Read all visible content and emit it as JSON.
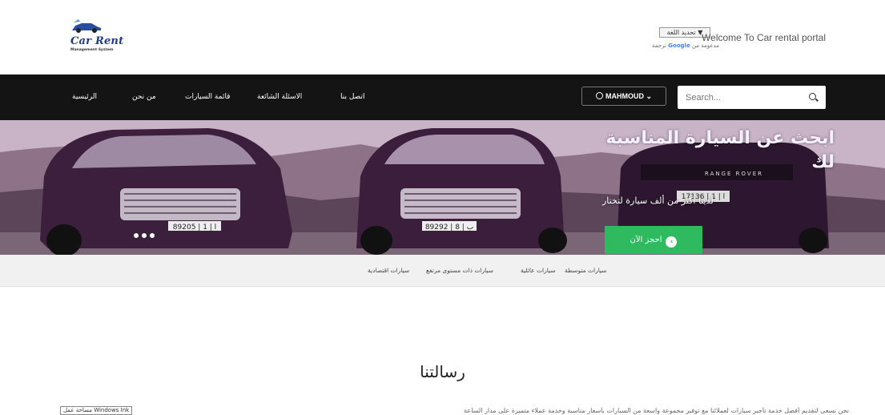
{
  "header": {
    "brand_name": "Car Rent",
    "brand_tagline": "Management System",
    "welcome_text": "Welcome To Car rental portal",
    "language_select": "تحديد اللغة ▼",
    "translate_powered": "مدعومة من",
    "translate_google": "Google",
    "translate_label": "ترجمة"
  },
  "nav": {
    "items": [
      {
        "label": "الرئيسية"
      },
      {
        "label": "من نحن"
      },
      {
        "label": "قائمة السيارات"
      },
      {
        "label": "الاسئلة الشائعة"
      },
      {
        "label": "اتصل بنا"
      }
    ],
    "user_label": "MAHMOUD",
    "search_placeholder": "Search..."
  },
  "hero": {
    "title": "ابحث عن السيارة المناسبة لك",
    "subtitle": "لدينا أكثر من ألف سيارة لتختار",
    "cta_label": "احجز الآن",
    "plates": [
      "89205 | ا | 1",
      "89292 | ب | 8",
      "17136 | ا | 1"
    ],
    "rover_text": "RANGE ROVER"
  },
  "categories": [
    {
      "label": "سيارات متوسطة"
    },
    {
      "label": "سيارات عائلية"
    },
    {
      "label": "سيارات ذات مستوى مرتفع"
    },
    {
      "label": "سيارات اقتصادية"
    }
  ],
  "mission": {
    "title": "رسالتنا",
    "body": "نحن نسعى لتقديم أفضل خدمة تأجير سيارات لعملائنا مع توفير مجموعة واسعة من السيارات بأسعار مناسبة وخدمة عملاء متميزة على مدار الساعة",
    "ink_tag": "مساحة عمل Windows Ink"
  },
  "colors": {
    "navbar_bg": "#141414",
    "cta_green": "#2fba5f",
    "category_bar_bg": "#f1f1f1",
    "brand_blue": "#1f3a8a"
  }
}
